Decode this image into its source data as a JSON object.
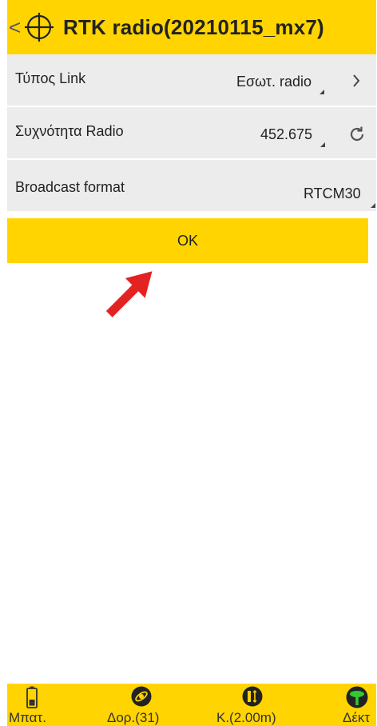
{
  "header": {
    "back_glyph": "<",
    "title": "RTK radio(20210115_mx7)",
    "icon": "gnss-crosshair-icon"
  },
  "rows": [
    {
      "label": "Τύπος Link",
      "value": "Εσωτ. radio",
      "action_icon": "chevron-right-icon"
    },
    {
      "label": "Συχνότητα Radio",
      "value": "452.675",
      "action_icon": "refresh-icon"
    },
    {
      "label": "Broadcast format",
      "value": "RTCM30"
    }
  ],
  "ok_label": "OK",
  "annotation": {
    "icon": "red-arrow-icon",
    "color": "#e32322"
  },
  "bottom_tabs": [
    {
      "label": "Μπατ.",
      "icon": "battery-icon"
    },
    {
      "label": "Δορ.(31)",
      "icon": "satellite-icon"
    },
    {
      "label": "Κ.(2.00m)",
      "icon": "pole-height-icon"
    },
    {
      "label": "Δέκτ",
      "icon": "receiver-icon"
    }
  ],
  "colors": {
    "accent": "#ffd400",
    "row_bg": "#ececec"
  }
}
